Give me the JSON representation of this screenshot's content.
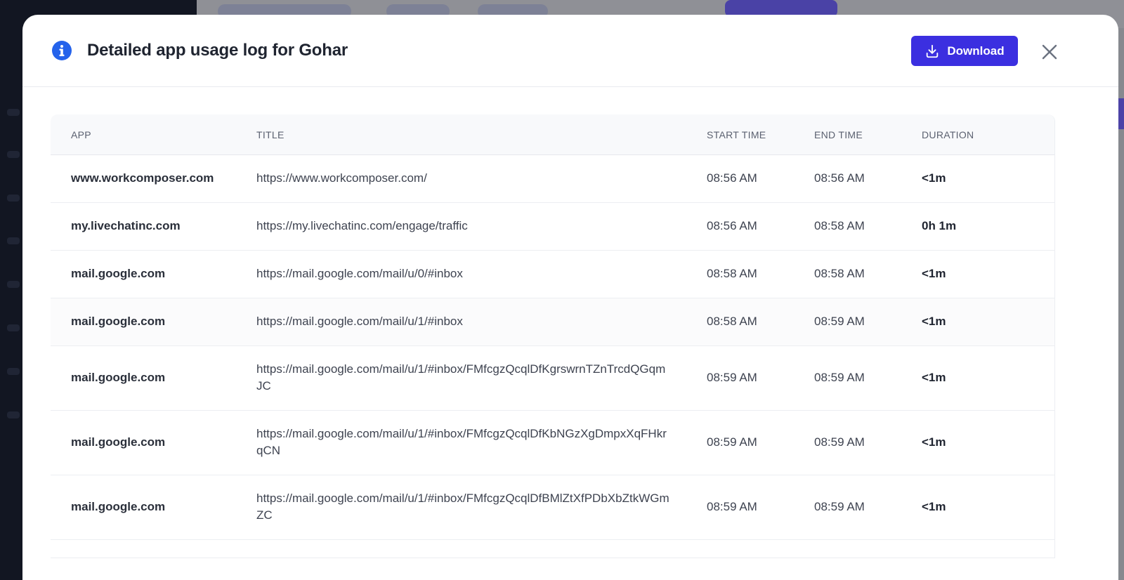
{
  "modal": {
    "title": "Detailed app usage log for Gohar",
    "download_label": "Download"
  },
  "table": {
    "headers": {
      "app": "APP",
      "title": "TITLE",
      "start": "START TIME",
      "end": "END TIME",
      "duration": "DURATION"
    },
    "rows": [
      {
        "app": "www.workcomposer.com",
        "title": "https://www.workcomposer.com/",
        "start": "08:56 AM",
        "end": "08:56 AM",
        "duration": "<1m"
      },
      {
        "app": "my.livechatinc.com",
        "title": "https://my.livechatinc.com/engage/traffic",
        "start": "08:56 AM",
        "end": "08:58 AM",
        "duration": "0h 1m"
      },
      {
        "app": "mail.google.com",
        "title": "https://mail.google.com/mail/u/0/#inbox",
        "start": "08:58 AM",
        "end": "08:58 AM",
        "duration": "<1m"
      },
      {
        "app": "mail.google.com",
        "title": "https://mail.google.com/mail/u/1/#inbox",
        "start": "08:58 AM",
        "end": "08:59 AM",
        "duration": "<1m"
      },
      {
        "app": "mail.google.com",
        "title": "https://mail.google.com/mail/u/1/#inbox/FMfcgzQcqlDfKgrswrnTZnTrcdQGqmJC",
        "start": "08:59 AM",
        "end": "08:59 AM",
        "duration": "<1m"
      },
      {
        "app": "mail.google.com",
        "title": "https://mail.google.com/mail/u/1/#inbox/FMfcgzQcqlDfKbNGzXgDmpxXqFHkrqCN",
        "start": "08:59 AM",
        "end": "08:59 AM",
        "duration": "<1m"
      },
      {
        "app": "mail.google.com",
        "title": "https://mail.google.com/mail/u/1/#inbox/FMfcgzQcqlDfBMlZtXfPDbXbZtkWGmZC",
        "start": "08:59 AM",
        "end": "08:59 AM",
        "duration": "<1m"
      }
    ]
  },
  "colors": {
    "accent": "#3b2fe0",
    "info_icon": "#2563eb"
  },
  "icons": {
    "info": "info-circle-icon",
    "download": "download-icon",
    "close": "close-icon"
  }
}
